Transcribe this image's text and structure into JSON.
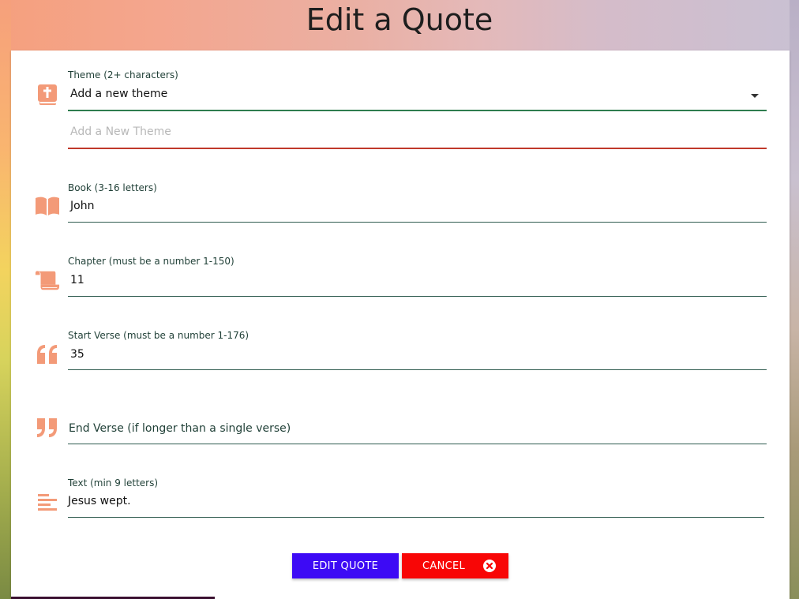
{
  "page": {
    "title": "Edit a Quote"
  },
  "form": {
    "theme": {
      "label": "Theme (2+ characters)",
      "selected": "Add a new theme",
      "new_theme_placeholder": "Add a New Theme",
      "icon": "bible-icon"
    },
    "book": {
      "label": "Book (3-16 letters)",
      "value": "John",
      "icon": "open-book-icon"
    },
    "chapter": {
      "label": "Chapter (must be a number 1-150)",
      "value": "11",
      "icon": "scroll-icon"
    },
    "start_verse": {
      "label": "Start Verse (must be a number 1-176)",
      "value": "35",
      "icon": "quote-left-icon"
    },
    "end_verse": {
      "label": "End Verse (if longer than a single verse)",
      "value": "",
      "icon": "quote-right-icon"
    },
    "text": {
      "label": "Text (min 9 letters)",
      "value": "Jesus wept.",
      "icon": "align-left-icon"
    }
  },
  "buttons": {
    "edit_label": "EDIT QUOTE",
    "cancel_label": "CANCEL",
    "cancel_icon": "times-circle-icon"
  },
  "colors": {
    "icon": "#f39a78",
    "underline": "#2f5b4f",
    "theme_underline_active": "#2f7d4f",
    "new_theme_underline_invalid": "#c0392b",
    "edit_button": "#3d0af5",
    "cancel_button": "#f80606"
  }
}
